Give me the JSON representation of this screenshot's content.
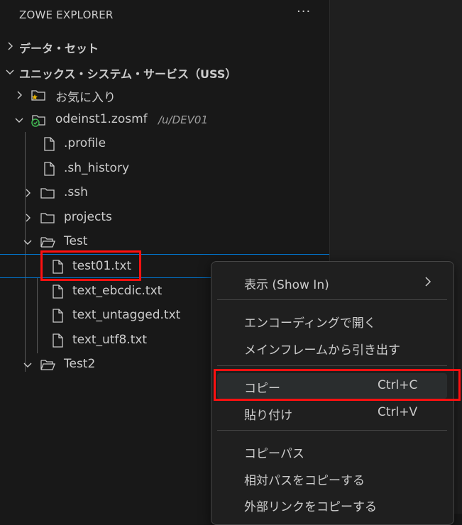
{
  "panel": {
    "title": "ZOWE EXPLORER",
    "more_icon": "···"
  },
  "tree": {
    "datasets": {
      "label": "データ・セット",
      "expanded": false
    },
    "uss": {
      "label": "ユニックス・システム・サービス（USS）",
      "expanded": true
    },
    "favorites": {
      "label": "お気に入り",
      "expanded": false
    },
    "profile": {
      "label": "odeinst1.zosmf",
      "path": "/u/DEV01",
      "expanded": true
    },
    "items": {
      "profile_file": ".profile",
      "sh_history": ".sh_history",
      "ssh": ".ssh",
      "projects": "projects",
      "test": "Test",
      "test01": "test01.txt",
      "text_ebcdic": "text_ebcdic.txt",
      "text_untagged": "text_untagged.txt",
      "text_utf8": "text_utf8.txt",
      "test2": "Test2"
    }
  },
  "context_menu": {
    "show_in": "表示 (Show In)",
    "open_with_encoding": "エンコーディングで開く",
    "pull_from_mainframe": "メインフレームから引き出す",
    "copy": {
      "label": "コピー",
      "shortcut": "Ctrl+C"
    },
    "paste": {
      "label": "貼り付け",
      "shortcut": "Ctrl+V"
    },
    "copy_path": "コピーパス",
    "copy_relative_path": "相対パスをコピーする",
    "copy_external_link": "外部リンクをコピーする"
  },
  "colors": {
    "background": "#181818",
    "selection_border": "#0078d4",
    "highlight_box": "#ff1010",
    "favorite_star": "#e8b400",
    "profile_check": "#3fb950",
    "menu_bg": "#1f1f1f",
    "text": "#cccccc"
  }
}
